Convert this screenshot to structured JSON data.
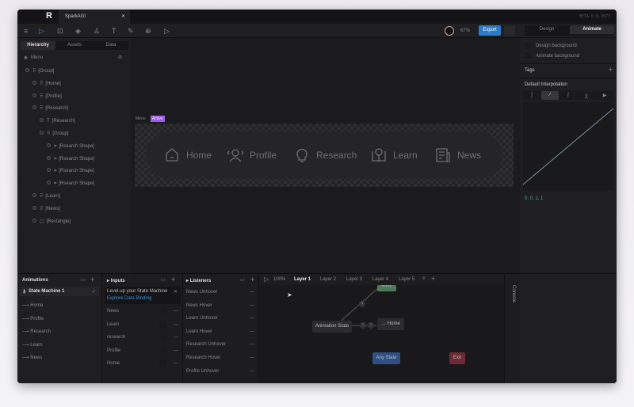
{
  "window": {
    "tab_title": "SparkAGI",
    "version": "BETA 0.8.3877",
    "zoom": "67%",
    "export": "Export",
    "mode_tabs": [
      "Design",
      "Animate"
    ],
    "active_mode": "Animate"
  },
  "left": {
    "tabs": [
      "Hierarchy",
      "Assets",
      "Data"
    ],
    "artboard": "Menu",
    "tree": [
      {
        "label": "[Group]",
        "depth": 0,
        "icon": "group"
      },
      {
        "label": "[Home]",
        "depth": 1,
        "icon": "group"
      },
      {
        "label": "[Profile]",
        "depth": 1,
        "icon": "group"
      },
      {
        "label": "[Research]",
        "depth": 1,
        "icon": "group"
      },
      {
        "label": "[Research]",
        "depth": 2,
        "icon": "text"
      },
      {
        "label": "[Group]",
        "depth": 2,
        "icon": "group"
      },
      {
        "label": "[Rsearch Shape]",
        "depth": 3,
        "icon": "shape"
      },
      {
        "label": "[Rsearch Shape]",
        "depth": 3,
        "icon": "shape"
      },
      {
        "label": "[Rsearch Shape]",
        "depth": 3,
        "icon": "shape"
      },
      {
        "label": "[Rsearch Shape]",
        "depth": 3,
        "icon": "shape"
      },
      {
        "label": "[Learn]",
        "depth": 1,
        "icon": "group"
      },
      {
        "label": "[News]",
        "depth": 1,
        "icon": "group"
      },
      {
        "label": "[Rectangle]",
        "depth": 1,
        "icon": "rect"
      }
    ]
  },
  "canvas": {
    "artboard_label": "Menu",
    "badge": "Active",
    "nav": [
      "Home",
      "Profile",
      "Research",
      "Learn",
      "News"
    ]
  },
  "right": {
    "design_bg": "Design background",
    "animate_bg": "Animate background",
    "tags": "Tags",
    "interp_title": "Default Interpolation",
    "curve_values": "0, 0, 1, 1"
  },
  "animations": {
    "title": "Animations",
    "state_machine": "State Machine 1",
    "items": [
      "Home",
      "Profile",
      "Research",
      "Learn",
      "News"
    ]
  },
  "inputs": {
    "title": "Inputs",
    "promo": "Level-up your State Machine",
    "promo_link": "Explore Data Binding",
    "items": [
      "News",
      "Learn",
      "research",
      "Profile",
      "Home"
    ]
  },
  "listeners": {
    "title": "Listeners",
    "items": [
      "News Unhover",
      "News Hover",
      "Learn Unhover",
      "Learn Hover",
      "Research Unhover",
      "Research Hover",
      "Profile Unhover"
    ]
  },
  "graph": {
    "zoom": "100%",
    "layers": [
      "Layer 1",
      "Layer 2",
      "Layer 3",
      "Layer 4",
      "Layer 5"
    ],
    "active_layer": "Layer 1",
    "entry": "Entry",
    "anim_state": "Animation State",
    "home": "→ Home",
    "any": "Any State",
    "exit": "Exit",
    "console": "Console"
  },
  "colors": {
    "accent": "#2d7bc4",
    "badge": "#9b5de5",
    "entry": "#4d7a5a",
    "any": "#2f4f86",
    "exit": "#6e2a34"
  }
}
